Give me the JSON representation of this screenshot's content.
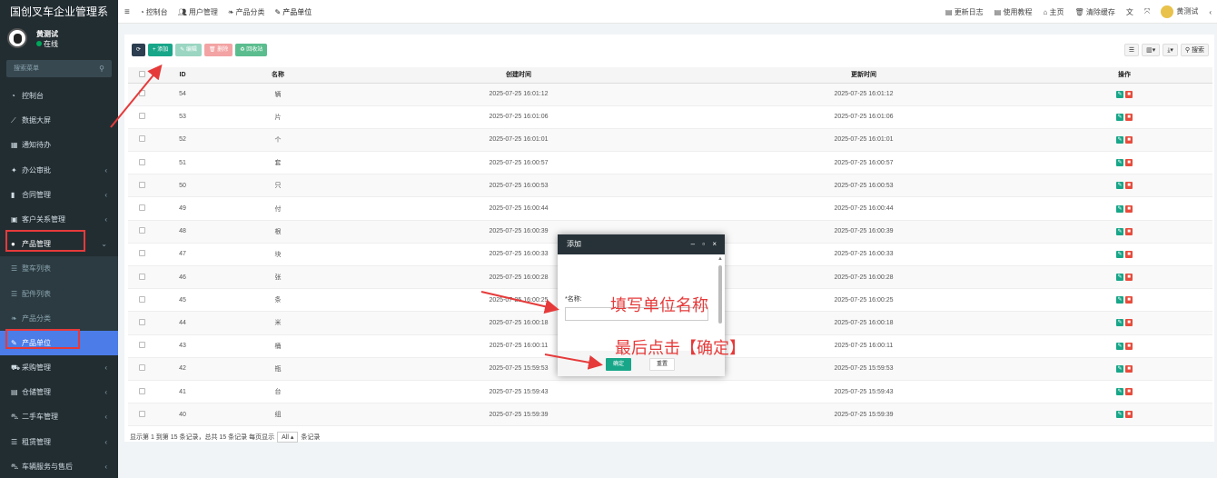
{
  "app": {
    "title": "国创叉车企业管理系",
    "accent": "#4b7ce8",
    "sidebar_bg": "#222d32"
  },
  "topnav": [
    {
      "icon": "dashboard-icon",
      "label": "控制台"
    },
    {
      "icon": "users-icon",
      "label": "用户管理"
    },
    {
      "icon": "leaf-icon",
      "label": "产品分类"
    },
    {
      "icon": "wrench-icon",
      "label": "产品单位"
    }
  ],
  "topright": {
    "changelog": "更新日志",
    "tutorial": "使用教程",
    "home": "主页",
    "clear_cache": "清除缓存",
    "user": "黄测试"
  },
  "user": {
    "name": "黄测试",
    "status": "在线"
  },
  "sidebar": {
    "search_placeholder": "搜索菜单",
    "items": [
      {
        "label": "控制台",
        "icon": "dashboard-icon",
        "has_children": false
      },
      {
        "label": "数据大屏",
        "icon": "chart-icon",
        "has_children": false
      },
      {
        "label": "通知待办",
        "icon": "calendar-icon",
        "has_children": false
      },
      {
        "label": "办公审批",
        "icon": "wand-icon",
        "has_children": true
      },
      {
        "label": "合同管理",
        "icon": "bookmark-icon",
        "has_children": true
      },
      {
        "label": "客户关系管理",
        "icon": "card-icon",
        "has_children": true
      },
      {
        "label": "产品管理",
        "icon": "circle-icon",
        "has_children": true,
        "open": true
      },
      {
        "label": "整车列表",
        "icon": "list-icon",
        "sub": true
      },
      {
        "label": "配件列表",
        "icon": "list-icon",
        "sub": true
      },
      {
        "label": "产品分类",
        "icon": "leaf-icon",
        "sub": true
      },
      {
        "label": "产品单位",
        "icon": "wrench-icon",
        "sub": true,
        "current": true
      },
      {
        "label": "采购管理",
        "icon": "cart-icon",
        "has_children": true
      },
      {
        "label": "仓储管理",
        "icon": "database-icon",
        "has_children": true
      },
      {
        "label": "二手车管理",
        "icon": "car-icon",
        "has_children": true
      },
      {
        "label": "租赁管理",
        "icon": "list-icon",
        "has_children": true
      },
      {
        "label": "车辆服务与售后",
        "icon": "car-icon",
        "has_children": true
      }
    ]
  },
  "toolbar": {
    "add": "添加",
    "edit": "编辑",
    "delete": "删除",
    "recycle": "回收站",
    "search": "搜索"
  },
  "table": {
    "headers": [
      "ID",
      "名称",
      "创建时间",
      "更新时间",
      "操作"
    ],
    "rows": [
      {
        "id": "54",
        "name": "辆",
        "created": "2025-07-25 16:01:12",
        "updated": "2025-07-25 16:01:12"
      },
      {
        "id": "53",
        "name": "片",
        "created": "2025-07-25 16:01:06",
        "updated": "2025-07-25 16:01:06"
      },
      {
        "id": "52",
        "name": "个",
        "created": "2025-07-25 16:01:01",
        "updated": "2025-07-25 16:01:01"
      },
      {
        "id": "51",
        "name": "套",
        "created": "2025-07-25 16:00:57",
        "updated": "2025-07-25 16:00:57"
      },
      {
        "id": "50",
        "name": "只",
        "created": "2025-07-25 16:00:53",
        "updated": "2025-07-25 16:00:53"
      },
      {
        "id": "49",
        "name": "付",
        "created": "2025-07-25 16:00:44",
        "updated": "2025-07-25 16:00:44"
      },
      {
        "id": "48",
        "name": "根",
        "created": "2025-07-25 16:00:39",
        "updated": "2025-07-25 16:00:39"
      },
      {
        "id": "47",
        "name": "块",
        "created": "2025-07-25 16:00:33",
        "updated": "2025-07-25 16:00:33"
      },
      {
        "id": "46",
        "name": "张",
        "created": "2025-07-25 16:00:28",
        "updated": "2025-07-25 16:00:28"
      },
      {
        "id": "45",
        "name": "条",
        "created": "2025-07-25 16:00:25",
        "updated": "2025-07-25 16:00:25"
      },
      {
        "id": "44",
        "name": "米",
        "created": "2025-07-25 16:00:18",
        "updated": "2025-07-25 16:00:18"
      },
      {
        "id": "43",
        "name": "桶",
        "created": "2025-07-25 16:00:11",
        "updated": "2025-07-25 16:00:11"
      },
      {
        "id": "42",
        "name": "瓶",
        "created": "2025-07-25 15:59:53",
        "updated": "2025-07-25 15:59:53"
      },
      {
        "id": "41",
        "name": "台",
        "created": "2025-07-25 15:59:43",
        "updated": "2025-07-25 15:59:43"
      },
      {
        "id": "40",
        "name": "组",
        "created": "2025-07-25 15:59:39",
        "updated": "2025-07-25 15:59:39"
      }
    ]
  },
  "footer": {
    "text": "显示第 1 到第 15 条记录，总共 15 条记录 每页显示",
    "page_size": "All",
    "suffix": "条记录"
  },
  "modal": {
    "title": "添加",
    "field_label": "*名称:",
    "ok": "确定",
    "reset": "重置"
  },
  "annotations": {
    "fill_name": "填写单位名称",
    "click_ok": "最后点击【确定】",
    "color": "#e63a3a"
  }
}
